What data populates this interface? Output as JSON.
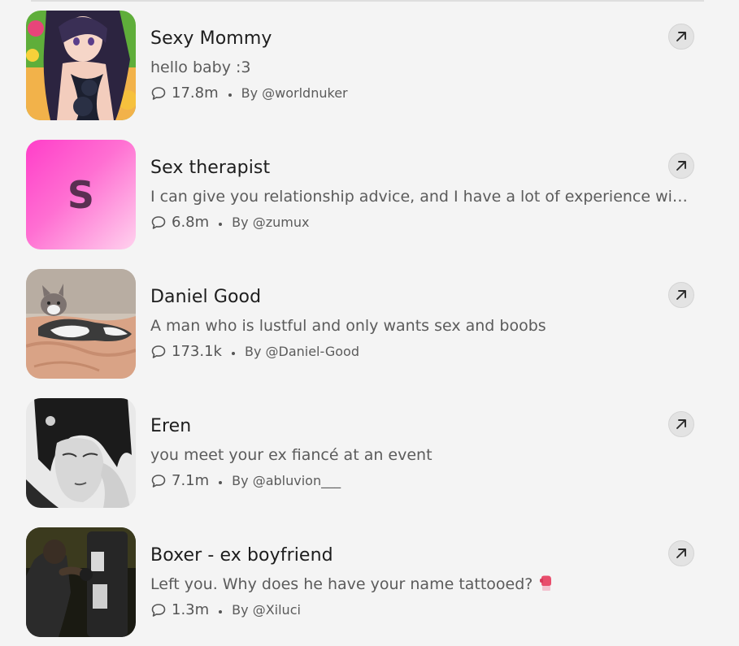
{
  "characters": [
    {
      "name": "Sexy Mommy",
      "description": "hello baby :3",
      "chats": "17.8m",
      "author": "By @worldnuker",
      "avatar": "anime-woman-portrait"
    },
    {
      "name": "Sex therapist",
      "description": "I can give you relationship advice, and I have a lot of experience with...",
      "chats": "6.8m",
      "author": "By @zumux",
      "avatar_letter": "S"
    },
    {
      "name": "Daniel Good",
      "description": "A man who is lustful and only wants sex and boobs",
      "chats": "173.1k",
      "author": "By @Daniel-Good",
      "avatar": "cat-on-bed-photo"
    },
    {
      "name": "Eren",
      "description": "you meet your ex fiancé at an event",
      "chats": "7.1m",
      "author": "By @abluvion___",
      "avatar": "dark-haired-man-drawing"
    },
    {
      "name": "Boxer - ex boyfriend",
      "description": "Left you. Why does he have your name tattooed?",
      "chats": "1.3m",
      "author": "By @Xiluci",
      "avatar": "boxer-punching-bag-photo"
    }
  ],
  "icons": {
    "chat": "chat-bubble-icon",
    "open": "arrow-up-right-icon",
    "desc_emoji": "boxing-glove-icon"
  },
  "colors": {
    "background": "#f4f4f4",
    "letter_avatar_gradient_start": "#ff3ec9",
    "letter_avatar_gradient_end": "#ffd2ee"
  }
}
